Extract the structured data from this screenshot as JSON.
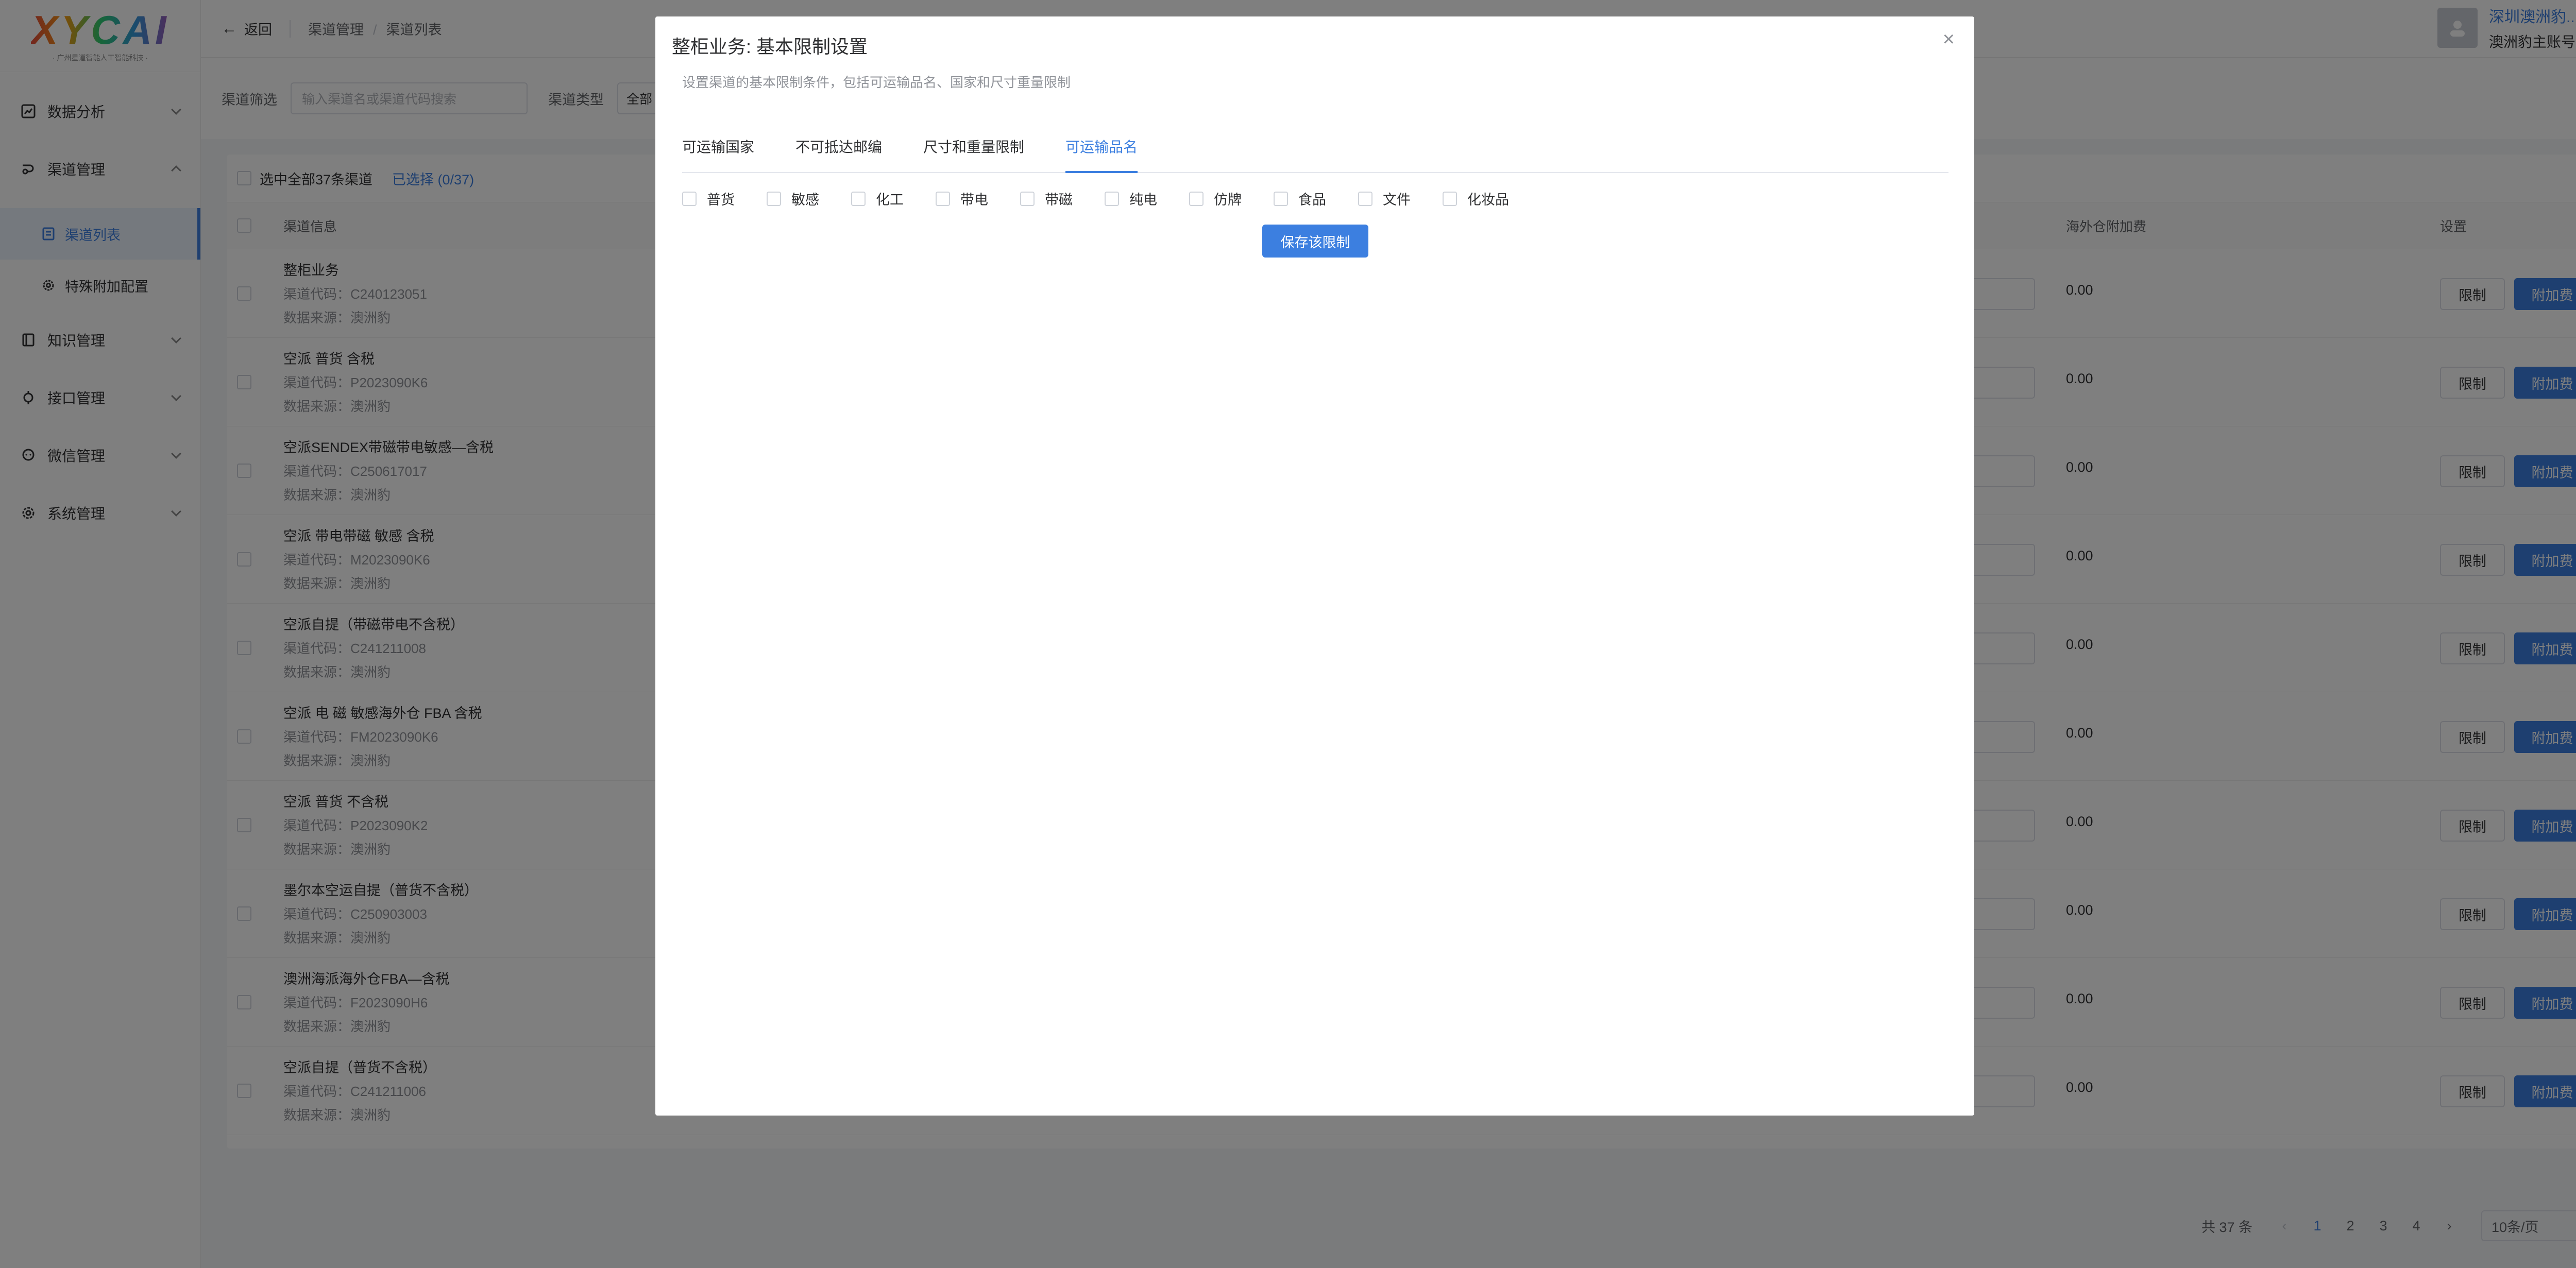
{
  "logo": {
    "subtitle": "· 广州星道智能人工智能科技 ·"
  },
  "sidebar": {
    "items": [
      {
        "label": "数据分析",
        "icon": "chart-icon"
      },
      {
        "label": "渠道管理",
        "icon": "channel-icon"
      },
      {
        "label": "知识管理",
        "icon": "book-icon"
      },
      {
        "label": "接口管理",
        "icon": "plug-icon"
      },
      {
        "label": "微信管理",
        "icon": "wechat-icon"
      },
      {
        "label": "系统管理",
        "icon": "gear-icon"
      }
    ],
    "sub_items": [
      {
        "label": "渠道列表",
        "icon": "list-icon",
        "active": true
      },
      {
        "label": "特殊附加配置",
        "icon": "settings-icon",
        "active": false
      }
    ]
  },
  "header": {
    "back_label": "返回",
    "breadcrumb": [
      "渠道管理",
      "渠道列表"
    ],
    "user_company": "深圳澳洲豹...",
    "user_account": "澳洲豹主账号"
  },
  "filter": {
    "channel_label": "渠道筛选",
    "channel_placeholder": "输入渠道名或渠道代码搜索",
    "type_label": "渠道类型",
    "type_value": "全部"
  },
  "table": {
    "select_all_label": "选中全部37条渠道",
    "selected_label": "已选择 (0/37)",
    "columns": {
      "info": "渠道信息",
      "fee": "海外仓附加费",
      "settings": "设置"
    },
    "code_prefix": "渠道代码：",
    "source_prefix": "数据来源：",
    "limit_label": "限制",
    "fee_button_label": "附加费",
    "rows": [
      {
        "name": "整柜业务",
        "code": "C240123051",
        "source": "澳洲豹",
        "fee": "0.00"
      },
      {
        "name": "空派 普货 含税",
        "code": "P2023090K6",
        "source": "澳洲豹",
        "fee": "0.00"
      },
      {
        "name": "空派SENDEX带磁带电敏感—含税",
        "code": "C250617017",
        "source": "澳洲豹",
        "fee": "0.00"
      },
      {
        "name": "空派 带电带磁 敏感 含税",
        "code": "M2023090K6",
        "source": "澳洲豹",
        "fee": "0.00"
      },
      {
        "name": "空派自提（带磁带电不含税）",
        "code": "C241211008",
        "source": "澳洲豹",
        "fee": "0.00"
      },
      {
        "name": "空派 电 磁 敏感海外仓 FBA 含税",
        "code": "FM2023090K6",
        "source": "澳洲豹",
        "fee": "0.00"
      },
      {
        "name": "空派 普货 不含税",
        "code": "P2023090K2",
        "source": "澳洲豹",
        "fee": "0.00"
      },
      {
        "name": "墨尔本空运自提（普货不含税）",
        "code": "C250903003",
        "source": "澳洲豹",
        "fee": "0.00"
      },
      {
        "name": "澳洲海派海外仓FBA—含税",
        "code": "F2023090H6",
        "source": "澳洲豹",
        "fee": "0.00"
      },
      {
        "name": "空派自提（普货不含税）",
        "code": "C241211006",
        "source": "澳洲豹",
        "fee": "0.00"
      }
    ]
  },
  "pagination": {
    "total": "共 37 条",
    "pages": [
      "1",
      "2",
      "3",
      "4"
    ],
    "current": "1",
    "prev": "‹",
    "next": "›",
    "page_size": "10条/页"
  },
  "dialog": {
    "title": "整柜业务: 基本限制设置",
    "description": "设置渠道的基本限制条件，包括可运输品名、国家和尺寸重量限制",
    "close_glyph": "×",
    "tabs": [
      {
        "label": "可运输国家",
        "active": false
      },
      {
        "label": "不可抵达邮编",
        "active": false
      },
      {
        "label": "尺寸和重量限制",
        "active": false
      },
      {
        "label": "可运输品名",
        "active": true
      }
    ],
    "categories": [
      "普货",
      "敏感",
      "化工",
      "带电",
      "带磁",
      "纯电",
      "仿牌",
      "食品",
      "文件",
      "化妆品"
    ],
    "save_label": "保存该限制"
  },
  "colors": {
    "accent": "#3c7fe0",
    "mask": "rgba(0,0,0,0.5)"
  }
}
